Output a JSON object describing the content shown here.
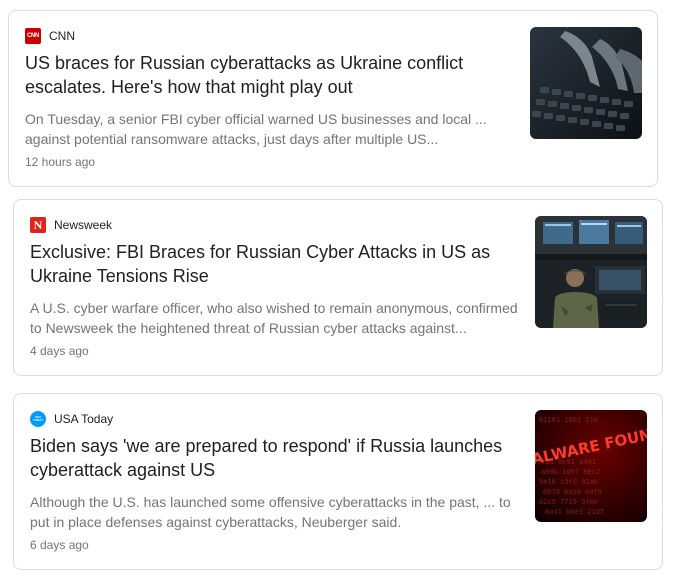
{
  "articles": [
    {
      "source": "CNN",
      "source_icon": "cnn-logo-icon",
      "headline_line1": "US braces for Russian cyberattacks as Ukraine conflict",
      "headline_line2": "escalates. Here's how that might play out",
      "snippet_line1": "On Tuesday, a senior FBI cyber official warned US businesses and local ...",
      "snippet_line2": "against potential ransomware attacks, just days after multiple US...",
      "time": "12 hours ago",
      "brand_color": "#cc0000"
    },
    {
      "source": "Newsweek",
      "source_icon": "newsweek-logo-icon",
      "headline_line1": "Exclusive: FBI Braces for Russian Cyber Attacks in US as",
      "headline_line2": "Ukraine Tensions Rise",
      "snippet_line1": "A U.S. cyber warfare officer, who also wished to remain anonymous, confirmed",
      "snippet_line2": "to Newsweek the heightened threat of Russian cyber attacks against...",
      "time": "4 days ago",
      "brand_color": "#e2231a"
    },
    {
      "source": "USA Today",
      "source_icon": "usa-today-logo-icon",
      "headline_line1": "Biden says 'we are prepared to respond' if Russia launches",
      "headline_line2": "cyberattack against US",
      "snippet_line1": "Although the U.S. has launched some offensive cyberattacks in the past, ... to",
      "snippet_line2": "put in place defenses against cyberattacks, Neuberger said.",
      "time": "6 days ago",
      "brand_color": "#009bff",
      "thumb_text": "MALWARE FOUND"
    }
  ],
  "logo_text": {
    "cnn": "CNN",
    "newsweek": "N",
    "usatoday": "USA TODAY"
  }
}
